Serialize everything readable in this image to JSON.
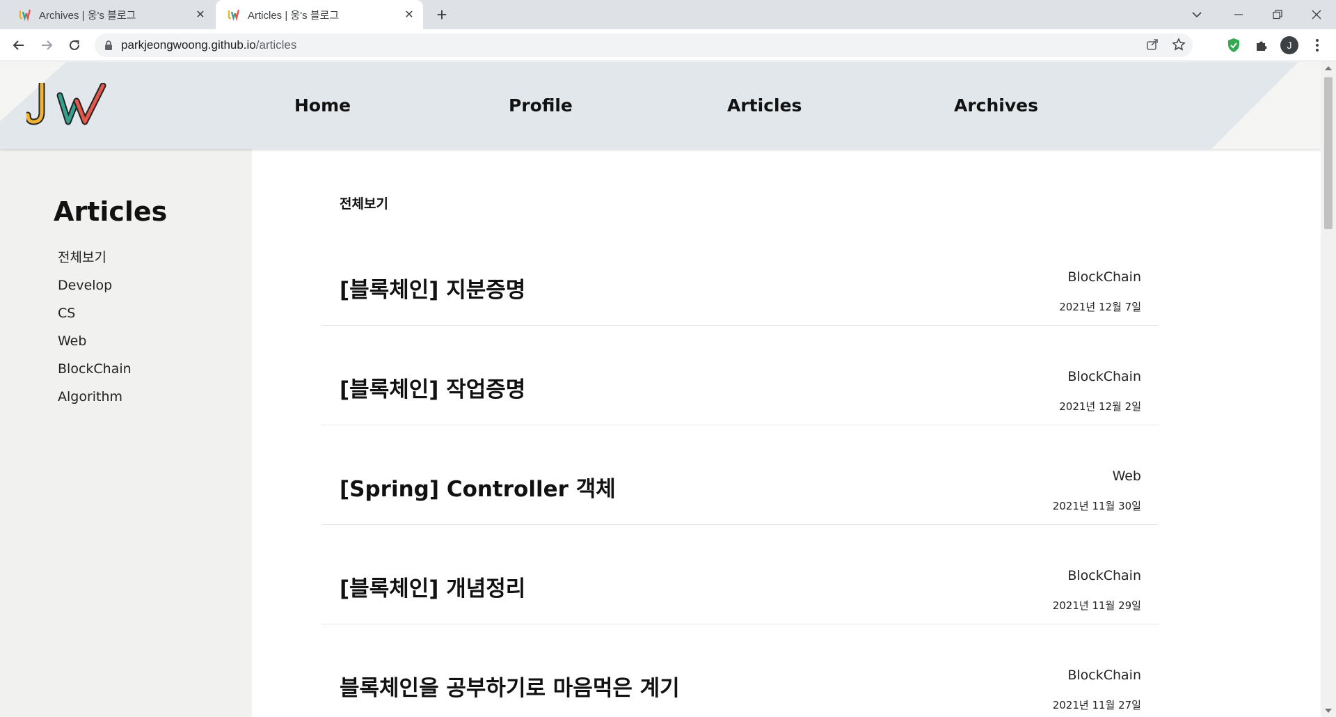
{
  "browser": {
    "tabs": [
      {
        "title": "Archives | 웅's 블로그",
        "active": false
      },
      {
        "title": "Articles | 웅's 블로그",
        "active": true
      }
    ],
    "url_host": "parkjeongwoong.github.io",
    "url_path": "/articles",
    "profile_initial": "J"
  },
  "site": {
    "nav": [
      "Home",
      "Profile",
      "Articles",
      "Archives"
    ],
    "header_band_color": "#e1e7ea",
    "logo_colors": [
      "#f2b233",
      "#36a08f",
      "#e4574b"
    ]
  },
  "sidebar": {
    "title": "Articles",
    "categories": [
      "전체보기",
      "Develop",
      "CS",
      "Web",
      "BlockChain",
      "Algorithm"
    ]
  },
  "main": {
    "breadcrumb": "전체보기",
    "posts": [
      {
        "title": "[블록체인] 지분증명",
        "category": "BlockChain",
        "date": "2021년 12월 7일"
      },
      {
        "title": "[블록체인] 작업증명",
        "category": "BlockChain",
        "date": "2021년 12월 2일"
      },
      {
        "title": "[Spring] Controller 객체",
        "category": "Web",
        "date": "2021년 11월 30일"
      },
      {
        "title": "[블록체인] 개념정리",
        "category": "BlockChain",
        "date": "2021년 11월 29일"
      },
      {
        "title": "블록체인을 공부하기로 마음먹은 계기",
        "category": "BlockChain",
        "date": "2021년 11월 27일"
      }
    ]
  }
}
